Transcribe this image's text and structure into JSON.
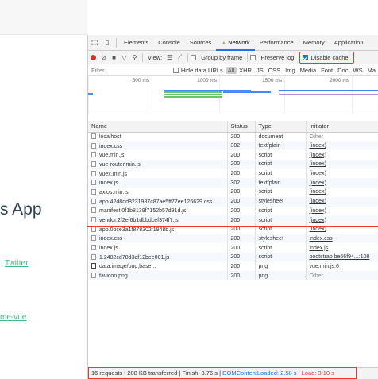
{
  "page": {
    "title_fragment": "s App",
    "twitter_link": "Twitter",
    "awesome_link": "me-vue"
  },
  "devtools": {
    "tabs": [
      "Elements",
      "Console",
      "Sources",
      "Network",
      "Performance",
      "Memory",
      "Application"
    ],
    "active_tab": "Network",
    "toolbar": {
      "view_label": "View:",
      "group_by_frame": "Group by frame",
      "preserve_log": "Preserve log",
      "disable_cache": "Disable cache",
      "disable_cache_checked": true
    },
    "filter": {
      "placeholder": "Filter",
      "hide_data_urls": "Hide data URLs",
      "types": [
        "All",
        "XHR",
        "JS",
        "CSS",
        "Img",
        "Media",
        "Font",
        "Doc",
        "WS",
        "Ma"
      ]
    },
    "timeline_ticks": [
      "500 ms",
      "1000 ms",
      "1500 ms",
      "2000 ms"
    ],
    "columns": [
      "Name",
      "Status",
      "Type",
      "Initiator"
    ],
    "rows": [
      {
        "name": "localhost",
        "status": "200",
        "type": "document",
        "initiator": "Other",
        "init_link": false,
        "icon": "file"
      },
      {
        "name": "index.css",
        "status": "302",
        "type": "text/plain",
        "initiator": "(index)",
        "init_link": true,
        "icon": "file"
      },
      {
        "name": "vue.min.js",
        "status": "200",
        "type": "script",
        "initiator": "(index)",
        "init_link": true,
        "icon": "file"
      },
      {
        "name": "vue-router.min.js",
        "status": "200",
        "type": "script",
        "initiator": "(index)",
        "init_link": true,
        "icon": "file"
      },
      {
        "name": "vuex.min.js",
        "status": "200",
        "type": "script",
        "initiator": "(index)",
        "init_link": true,
        "icon": "file"
      },
      {
        "name": "index.js",
        "status": "302",
        "type": "text/plain",
        "initiator": "(index)",
        "init_link": true,
        "icon": "file"
      },
      {
        "name": "axios.min.js",
        "status": "200",
        "type": "script",
        "initiator": "(index)",
        "init_link": true,
        "icon": "file"
      },
      {
        "name": "app.42d8dd8231987c87ae5ff77ee126629.css",
        "status": "200",
        "type": "stylesheet",
        "initiator": "(index)",
        "init_link": true,
        "icon": "file"
      },
      {
        "name": "manifest.0f1b8139f7152b57d91d.js",
        "status": "200",
        "type": "script",
        "initiator": "(index)",
        "init_link": true,
        "icon": "file"
      },
      {
        "name": "vendor.2f2ef6b1dbbdcef374f7.js",
        "status": "200",
        "type": "script",
        "initiator": "(index)",
        "init_link": true,
        "icon": "file"
      },
      {
        "name": "app.0bce3a1f878302f1948b.js",
        "status": "200",
        "type": "script",
        "initiator": "(index)",
        "init_link": true,
        "icon": "file"
      },
      {
        "name": "index.css",
        "status": "200",
        "type": "stylesheet",
        "initiator": "index.css",
        "init_link": true,
        "icon": "file"
      },
      {
        "name": "index.js",
        "status": "200",
        "type": "script",
        "initiator": "index.js",
        "init_link": true,
        "icon": "file"
      },
      {
        "name": "1.2482cd78d3af12bee001.js",
        "status": "200",
        "type": "script",
        "initiator": "bootstrap be66f94...:108",
        "init_link": true,
        "icon": "file"
      },
      {
        "name": "data:image/png;base...",
        "status": "200",
        "type": "png",
        "initiator": "vue.min.js:6",
        "init_link": true,
        "icon": "img"
      },
      {
        "name": "favicon.png",
        "status": "200",
        "type": "png",
        "initiator": "Other",
        "init_link": false,
        "icon": "file"
      }
    ],
    "status_bar": {
      "summary": "16 requests | 208 KB transferred | Finish: 3.76 s | ",
      "dom_content_loaded": "DOMContentLoaded: 2.58 s",
      "sep": " | ",
      "load": "Load: 3.10 s"
    }
  }
}
